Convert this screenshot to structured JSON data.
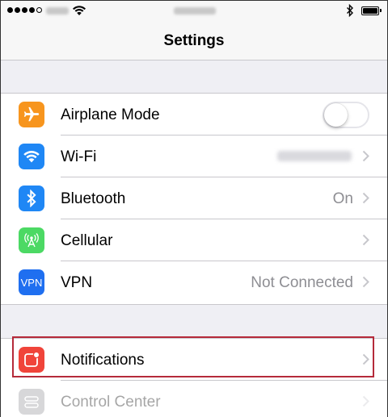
{
  "status_bar": {
    "signal_dots": 5,
    "signal_filled": 4
  },
  "nav": {
    "title": "Settings"
  },
  "colors": {
    "airplane": "#f7951e",
    "wifi": "#1f87f5",
    "bluetooth": "#1f87f5",
    "cellular": "#4cd964",
    "vpn": "#1f6ff0",
    "notifications": "#f0443a",
    "control_center": "#8e8e93",
    "highlight_border": "#b52a3a"
  },
  "group1": [
    {
      "id": "airplane",
      "label": "Airplane Mode",
      "icon": "airplane-icon",
      "toggle": true,
      "toggle_on": false
    },
    {
      "id": "wifi",
      "label": "Wi-Fi",
      "icon": "wifi-icon",
      "value": "AdobeCorp",
      "value_blurred": true
    },
    {
      "id": "bluetooth",
      "label": "Bluetooth",
      "icon": "bluetooth-icon",
      "value": "On"
    },
    {
      "id": "cellular",
      "label": "Cellular",
      "icon": "cellular-icon",
      "value": ""
    },
    {
      "id": "vpn",
      "label": "VPN",
      "icon": "vpn-icon",
      "icon_text": "VPN",
      "value": "Not Connected"
    }
  ],
  "group2": [
    {
      "id": "notifications",
      "label": "Notifications",
      "icon": "notifications-icon",
      "highlighted": true
    },
    {
      "id": "control-center",
      "label": "Control Center",
      "icon": "control-center-icon",
      "partially_visible": true
    }
  ]
}
